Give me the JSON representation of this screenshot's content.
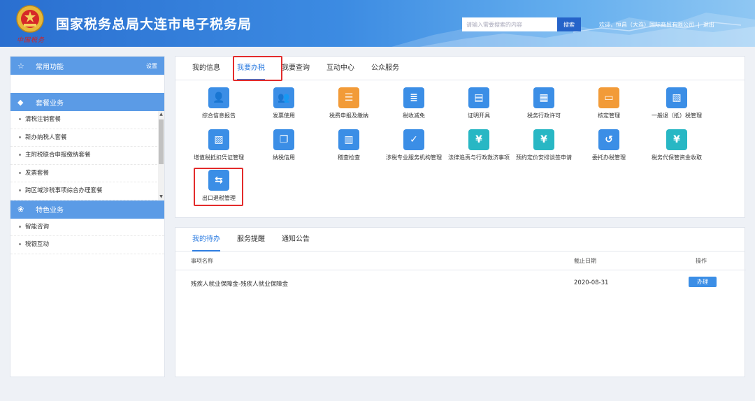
{
  "header": {
    "title": "国家税务总局大连市电子税务局",
    "logo_text": "中国税务",
    "search_placeholder": "请输入需要搜索的内容",
    "search_button": "搜索",
    "welcome": "欢迎，恒昌（大连）国际商贸有限公司",
    "separator": "|",
    "logout": "退出"
  },
  "sidebar": {
    "common_title": "常用功能",
    "common_setting": "设置",
    "package_title": "套餐业务",
    "package_items": [
      "清税注销套餐",
      "新办纳税人套餐",
      "主附税联合申报缴纳套餐",
      "发票套餐",
      "跨区域涉税事项综合办理套餐"
    ],
    "special_title": "特色业务",
    "special_items": [
      "智能咨询",
      "税银互动"
    ]
  },
  "main": {
    "tabs": [
      "我的信息",
      "我要办税",
      "我要查询",
      "互动中心",
      "公众服务"
    ],
    "active_tab": "我要办税",
    "services": [
      {
        "label": "综合信息报告",
        "icon": "person-card-icon",
        "color": "#3b8ee6"
      },
      {
        "label": "发票使用",
        "icon": "people-icon",
        "color": "#3b8ee6"
      },
      {
        "label": "税费申报及缴纳",
        "icon": "stack-icon",
        "color": "#f29b38"
      },
      {
        "label": "税收减免",
        "icon": "doc-list-icon",
        "color": "#3b8ee6"
      },
      {
        "label": "证明开具",
        "icon": "certificate-icon",
        "color": "#3b8ee6"
      },
      {
        "label": "税务行政许可",
        "icon": "doc-person-icon",
        "color": "#3b8ee6"
      },
      {
        "label": "核定管理",
        "icon": "monitor-icon",
        "color": "#f29b38"
      },
      {
        "label": "一般退（抵）税管理",
        "icon": "doc-refund-icon",
        "color": "#3b8ee6"
      },
      {
        "label": "增值税抵扣凭证管理",
        "icon": "doc-stamp-icon",
        "color": "#3b8ee6"
      },
      {
        "label": "纳税信用",
        "icon": "doc-copy-icon",
        "color": "#3b8ee6"
      },
      {
        "label": "稽查检查",
        "icon": "cabinet-icon",
        "color": "#3b8ee6"
      },
      {
        "label": "涉税专业服务机构管理",
        "icon": "doc-check-icon",
        "color": "#3b8ee6"
      },
      {
        "label": "法律追责与行政救济事项",
        "icon": "yen-search-icon",
        "color": "#28b7c4"
      },
      {
        "label": "预约定价安排谈签申请",
        "icon": "yen-search-icon",
        "color": "#28b7c4"
      },
      {
        "label": "委托办税管理",
        "icon": "history-icon",
        "color": "#3b8ee6"
      },
      {
        "label": "税务代保管资金收取",
        "icon": "yen-search-icon",
        "color": "#28b7c4"
      },
      {
        "label": "出口退税管理",
        "icon": "exchange-doc-icon",
        "color": "#3b8ee6"
      }
    ]
  },
  "todo": {
    "tabs": [
      "我的待办",
      "服务提醒",
      "通知公告"
    ],
    "active_tab": "我的待办",
    "columns": [
      "事项名称",
      "截止日期",
      "操作"
    ],
    "rows": [
      {
        "name": "残疾人就业保障金-残疾人就业保障金",
        "date": "2020-08-31",
        "action": "办理"
      }
    ]
  }
}
